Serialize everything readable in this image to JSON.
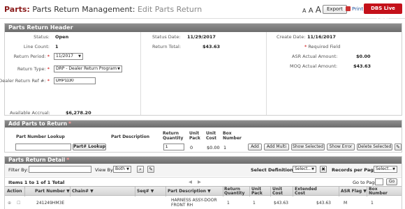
{
  "top": {
    "app": "Parts:",
    "section": "Parts Return Management:",
    "subsection": "Edit Parts Return",
    "font_small": "A",
    "font_medium": "A",
    "font_large": "A",
    "export_label": "Export",
    "print_label": "Print",
    "chat_label": "DBS Live Chat"
  },
  "header": {
    "title": "Parts Return Header",
    "status_label": "Status:",
    "status_value": "Open",
    "line_count_label": "Line Count:",
    "line_count_value": "1",
    "return_period_label": "Return Period:",
    "return_period_value": "11/2017",
    "return_type_label": "Return Type:",
    "return_type_value": "DRP - Dealer Return Program",
    "dealer_ref_label": "Dealer Return Ref #:",
    "dealer_ref_value": "DRP1130",
    "available_accrual_label": "Available Accrual:",
    "available_accrual_value": "$6,278.20",
    "status_date_label": "Status Date:",
    "status_date_value": "11/29/2017",
    "return_total_label": "Return Total:",
    "return_total_value": "$43.63",
    "create_date_label": "Create Date:",
    "create_date_value": "11/16/2017",
    "required_field_label": "Required Field",
    "asr_label": "ASR Actual Amount:",
    "asr_value": "$0.00",
    "moq_label": "MOQ Actual Amount:",
    "moq_value": "$43.63"
  },
  "add_parts": {
    "title": "Add Parts to Return",
    "col_lookup": "Part Number Lookup",
    "col_description": "Part Description",
    "col_qty": "Return Quantity",
    "col_unit_pack": "Unit Pack",
    "col_unit_cost": "Unit Cost",
    "col_box": "Box Number",
    "lookup_button": "Part# Lookup",
    "qty_value": "1",
    "unit_pack_value": "0",
    "unit_cost_value": "$0.00",
    "box_value": "1",
    "add_button": "Add",
    "add_multi_button": "Add Multi",
    "show_selected_button": "Show Selected",
    "show_error_button": "Show Error",
    "delete_selected_button": "Delete Selected"
  },
  "detail": {
    "title": "Parts Return Detail",
    "filter_label": "Filter By:",
    "view_label": "View By:",
    "view_value": "Both",
    "select_def_label": "Select Definition:",
    "select_def_value": "Select...",
    "records_label": "Records per Page:",
    "records_value": "Select...",
    "items_text": "Items 1 to 1 of 1 Total",
    "goto_label": "Go to Page",
    "go_button": "Go",
    "columns": [
      "Action",
      "Part Number",
      "Chain#",
      "Seq#",
      "Part Description",
      "Return Quantity",
      "Unit Pack",
      "Unit Cost",
      "Extended Cost",
      "ASR Flag",
      "Box Number"
    ],
    "row": {
      "part_number": "241249HM3E",
      "description": "HARNESS ASSY-DOOR FRONT RH",
      "quantity": "1",
      "unit_pack": "1",
      "unit_cost": "$43.63",
      "extended_cost": "$43.63",
      "asr_flag": "M",
      "box_number": "1"
    }
  }
}
